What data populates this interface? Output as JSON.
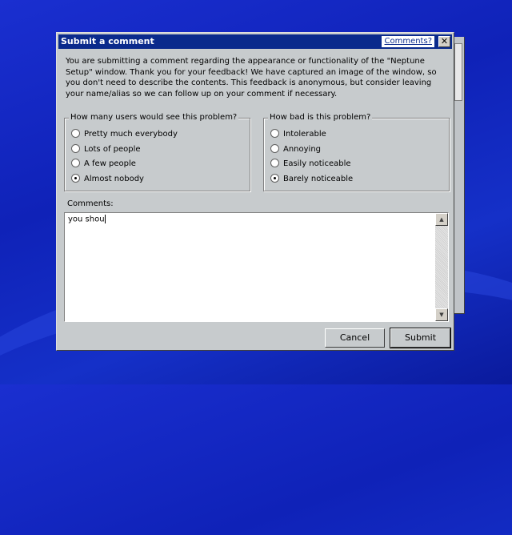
{
  "window": {
    "title": "Submit a comment",
    "comments_link": "Comments?",
    "close_glyph": "✕",
    "intro": "You are submitting a comment regarding the appearance or functionality of the \"Neptune Setup\" window. Thank you for your feedback! We have captured an image of the window, so you don't need to describe the contents. This feedback is anonymous, but consider leaving your name/alias so we can follow up on your comment if necessary."
  },
  "users_group": {
    "legend": "How many users would see this problem?",
    "options": [
      "Pretty much everybody",
      "Lots of people",
      "A few people",
      "Almost nobody"
    ],
    "selected": "Almost nobody"
  },
  "severity_group": {
    "legend": "How bad is this problem?",
    "options": [
      "Intolerable",
      "Annoying",
      "Easily noticeable",
      "Barely noticeable"
    ],
    "selected": "Barely noticeable"
  },
  "comments": {
    "label": "Comments:",
    "value": "you shou"
  },
  "buttons": {
    "cancel": "Cancel",
    "submit": "Submit"
  },
  "icons": {
    "close": "close-icon",
    "scroll_up": "scroll-up-arrow-icon",
    "scroll_down": "scroll-down-arrow-icon"
  }
}
